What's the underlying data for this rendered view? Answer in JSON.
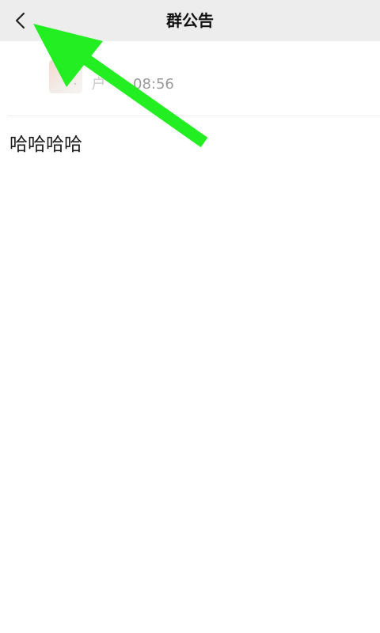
{
  "nav": {
    "title": "群公告",
    "back_icon": "chevron-left-icon"
  },
  "announcement": {
    "author_name": "· 户 ·",
    "time": "08:56",
    "content": "哈哈哈哈"
  },
  "annotation": {
    "arrow_color": "#22ee22",
    "points_to": "back-button"
  }
}
